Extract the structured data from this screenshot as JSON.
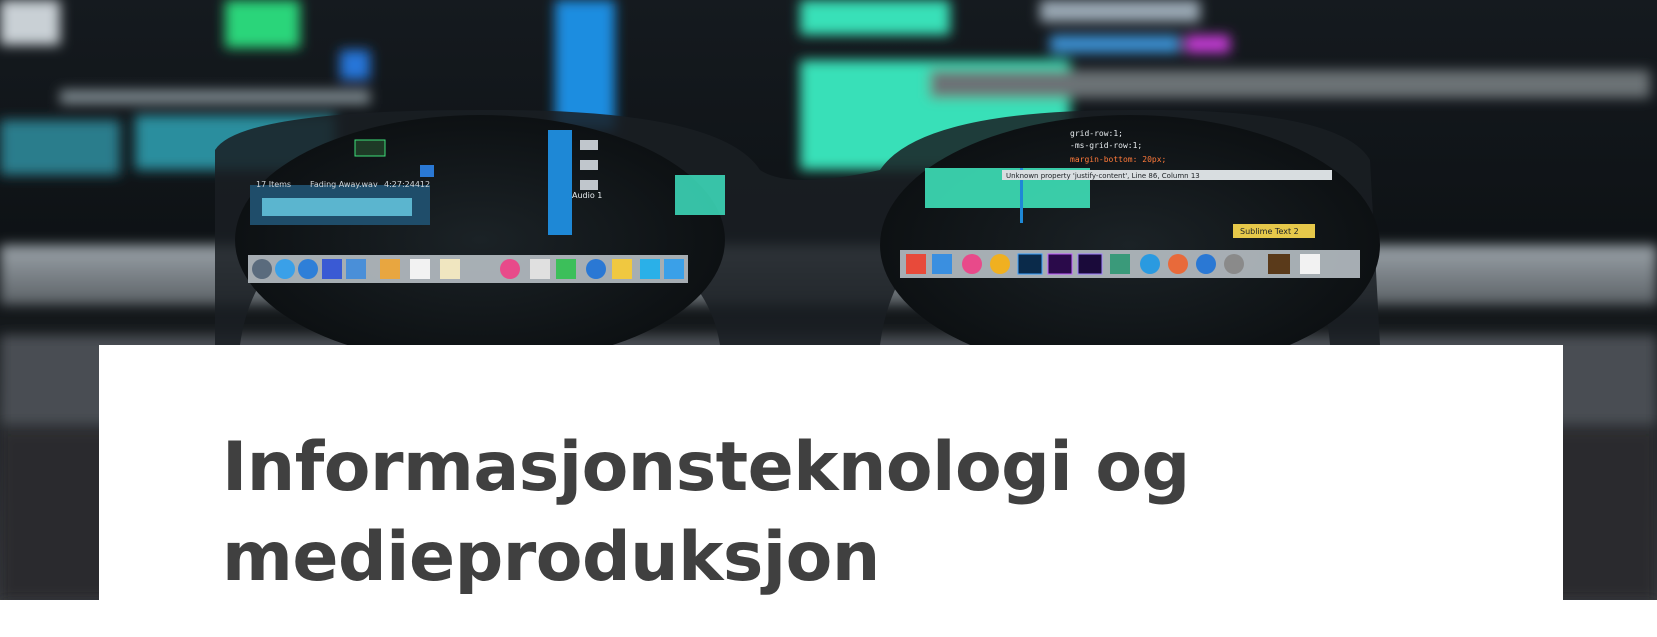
{
  "hero": {
    "image_icon": "photo-of-eyeglasses-in-front-of-computer-screens",
    "colors": {
      "background": "#0b0d10",
      "waveform": "#2ee0c0",
      "timeline_blue": "#1e88d6"
    },
    "screen_text": {
      "left_track_count": "17 Items",
      "left_track_name": "Fading Away.wav",
      "left_track_time": "4:27:24412",
      "audio_track": "Audio 1",
      "code_line_1": "grid-row:1;",
      "code_line_2": "-ms-grid-row:1;",
      "code_line_3": "margin-bottom: 20px;",
      "error_message": "Unknown property 'justify-content', Line 86, Column 13",
      "tooltip": "Sublime Text 2"
    }
  },
  "card": {
    "title_line_1": "Informasjonsteknologi og",
    "title_line_2": "medieproduksjon",
    "title_color": "#404040"
  }
}
